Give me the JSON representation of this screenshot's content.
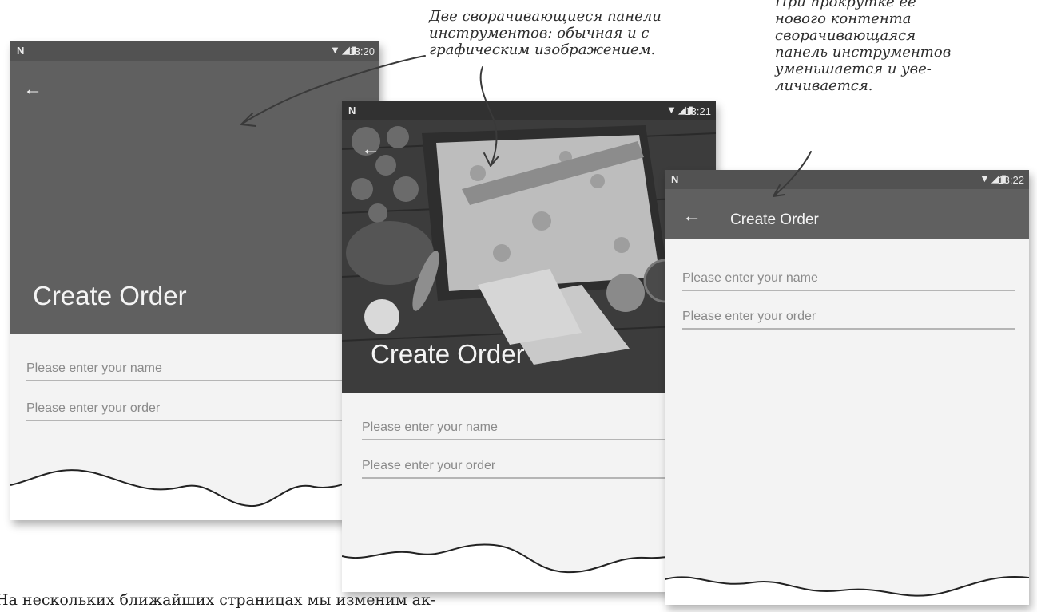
{
  "screens": [
    {
      "status": {
        "carrier_glyph": "N",
        "icons": "▼◢▮",
        "time": "13:20"
      },
      "toolbar": {
        "title": "Create Order",
        "has_image": false,
        "color": "#606060"
      },
      "fields": {
        "name_placeholder": "Please enter your name",
        "order_placeholder": "Please enter your order"
      }
    },
    {
      "status": {
        "carrier_glyph": "N",
        "icons": "▼◢▮",
        "time": "13:21"
      },
      "toolbar": {
        "title": "Create Order",
        "has_image": true,
        "image": "pizza-on-dark-wooden-table"
      },
      "fields": {
        "name_placeholder": "Please enter your name",
        "order_placeholder": "Please enter your order"
      }
    },
    {
      "status": {
        "carrier_glyph": "N",
        "icons": "▼◢▮",
        "time": "13:22"
      },
      "toolbar": {
        "title": "Create Order",
        "has_image": false,
        "collapsed": true,
        "color": "#606060"
      },
      "fields": {
        "name_placeholder": "Please enter your name",
        "order_placeholder": "Please enter your order"
      }
    }
  ],
  "annotations": {
    "two_toolbars": [
      "Две сворачивающиеся панели",
      "инструментов: обычная и с",
      "графическим изображением."
    ],
    "scroll_behavior": [
      "При прокрутке ее",
      "нового контента",
      "сворачивающаяся",
      "панель инструментов",
      "уменьшается и уве-",
      "личивается."
    ]
  },
  "footer_text": "На нескольких ближайших страницах мы изменим ак-",
  "icons": {
    "back": "arrow-left-icon",
    "wifi": "wifi-icon",
    "signal": "signal-icon",
    "battery": "battery-icon"
  }
}
